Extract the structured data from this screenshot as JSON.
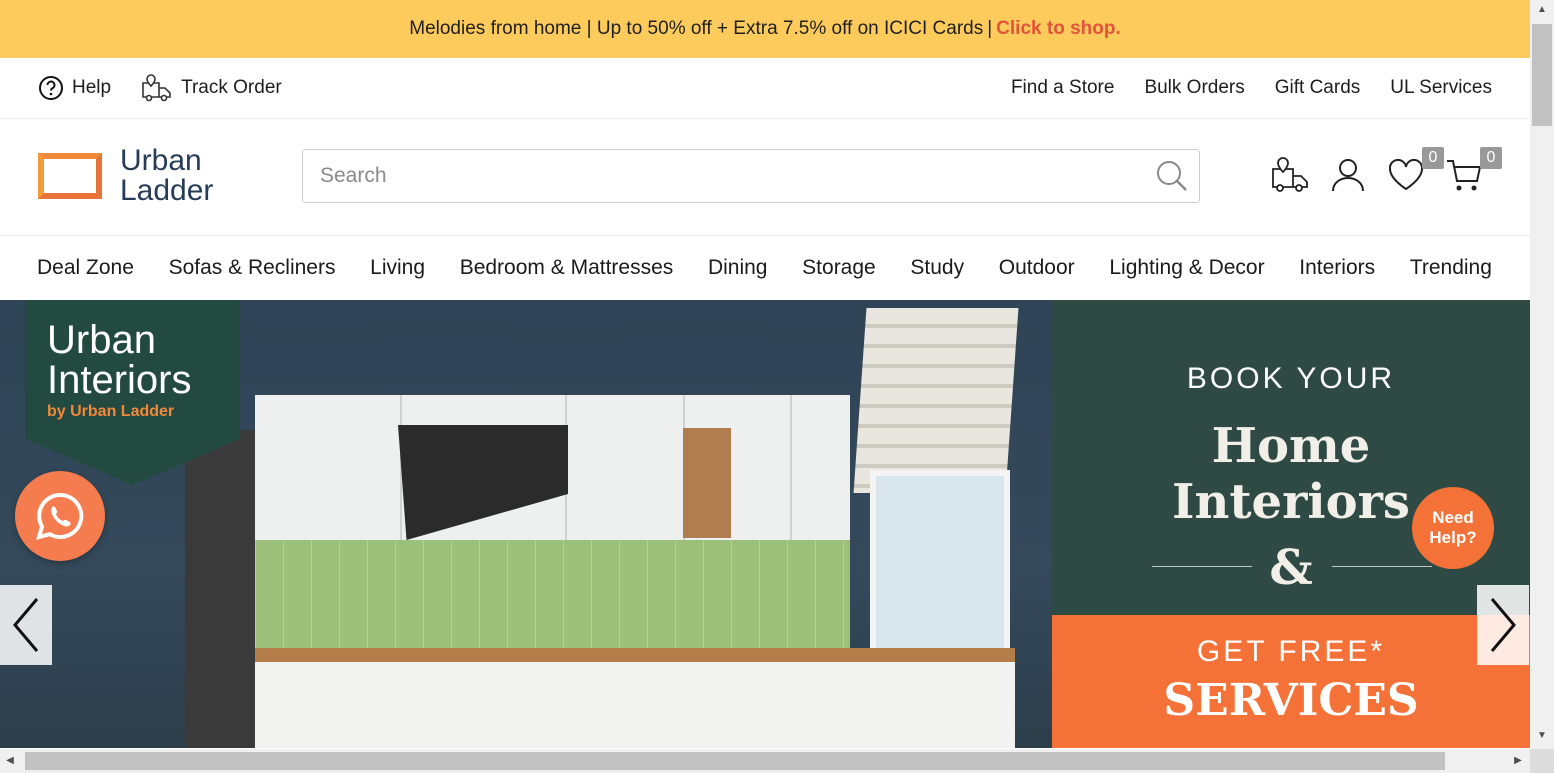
{
  "promo_bar": {
    "text": "Melodies from home | Up to 50% off + Extra 7.5% off on ICICI Cards",
    "separator": "|",
    "cta": "Click to shop."
  },
  "utility": {
    "help": "Help",
    "track_order": "Track Order",
    "links": [
      "Find a Store",
      "Bulk Orders",
      "Gift Cards",
      "UL Services"
    ]
  },
  "header": {
    "logo_line1": "Urban",
    "logo_line2": "Ladder",
    "search_placeholder": "Search",
    "wishlist_count": "0",
    "cart_count": "0"
  },
  "nav": [
    "Deal Zone",
    "Sofas & Recliners",
    "Living",
    "Bedroom & Mattresses",
    "Dining",
    "Storage",
    "Study",
    "Outdoor",
    "Lighting & Decor",
    "Interiors",
    "Trending"
  ],
  "banner": {
    "brand_line1": "Urban",
    "brand_line2": "Interiors",
    "brand_sub": "by Urban Ladder",
    "book_your": "BOOK YOUR",
    "home": "Home",
    "interiors": "Interiors",
    "amp": "&",
    "get_free": "GET FREE*",
    "services": "SERVICES",
    "need_help_1": "Need",
    "need_help_2": "Help?"
  },
  "colors": {
    "promo_bg": "#fdcb5b",
    "cta": "#e2533c",
    "accent_orange": "#f47238",
    "logo_navy": "#263c57",
    "badge_green": "#234a40"
  },
  "icons": [
    "help-circle-icon",
    "truck-icon",
    "search-icon",
    "delivery-truck-icon",
    "user-icon",
    "heart-icon",
    "cart-icon",
    "whatsapp-icon",
    "chevron-left-icon",
    "chevron-right-icon"
  ]
}
